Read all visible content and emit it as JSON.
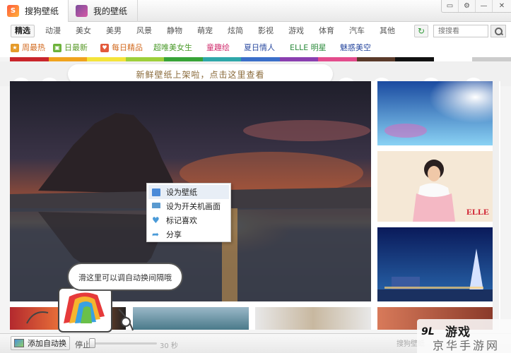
{
  "window": {
    "tabs": [
      {
        "label": "搜狗壁纸",
        "active": true
      },
      {
        "label": "我的壁纸",
        "active": false
      }
    ],
    "controls": [
      "restore-icon",
      "pin-icon",
      "minimize-icon",
      "close-icon"
    ]
  },
  "categories": [
    "精选",
    "动漫",
    "美女",
    "美男",
    "风景",
    "静物",
    "萌宠",
    "炫简",
    "影视",
    "游戏",
    "体育",
    "汽车",
    "其他"
  ],
  "selected_category": "精选",
  "search": {
    "placeholder": "搜搜看"
  },
  "subcategories": [
    {
      "label": "周最热",
      "color": "#d2691e",
      "icon_color": "#e59b2b"
    },
    {
      "label": "日最新",
      "color": "#5a9a2a",
      "icon_color": "#6cb23a"
    },
    {
      "label": "每日精品",
      "color": "#d2691e",
      "icon_color": "#e35a3c"
    },
    {
      "label": "超唯美女生",
      "color": "#4a9a2a"
    },
    {
      "label": "童趣绘",
      "color": "#d02e6e"
    },
    {
      "label": "夏日情人",
      "color": "#2a4aa0"
    },
    {
      "label": "ELLE 明星",
      "color": "#2a8a3a"
    },
    {
      "label": "魅惑美空",
      "color": "#2a4aa0"
    }
  ],
  "color_strip": [
    "#c9252b",
    "#f0a31e",
    "#f4e43a",
    "#9ecf3a",
    "#37a337",
    "#2ea7a9",
    "#3a6fc9",
    "#8a3fb0",
    "#e34c8c",
    "#5a3a2a",
    "#111111",
    "#ffffff",
    "#cccccc"
  ],
  "banner": {
    "text": "新鲜壁纸上架啦，点击这里查看"
  },
  "context_menu": [
    {
      "label": "设为壁纸",
      "icon": "image-icon"
    },
    {
      "label": "设为开关机画面",
      "icon": "monitor-icon"
    },
    {
      "label": "标记喜欢",
      "icon": "heart-icon"
    },
    {
      "label": "分享",
      "icon": "share-icon"
    }
  ],
  "bubble": {
    "text": "滑这里可以调自动换间隔哦"
  },
  "thumbnails": [
    {
      "name": "sky-lens-flare"
    },
    {
      "name": "woman-portrait",
      "label": "ELLE"
    },
    {
      "name": "city-night"
    },
    {
      "name": "bottom-1"
    },
    {
      "name": "bottom-2"
    },
    {
      "name": "bottom-3"
    },
    {
      "name": "bottom-4"
    }
  ],
  "bottombar": {
    "auto_label": "添加自动换",
    "stop_label": "停止",
    "seconds_label": "30 秒",
    "brand_text": "搜狗壁纸"
  },
  "watermark": {
    "logo": "9L",
    "line1": "游戏",
    "line2": "京华手游网"
  }
}
